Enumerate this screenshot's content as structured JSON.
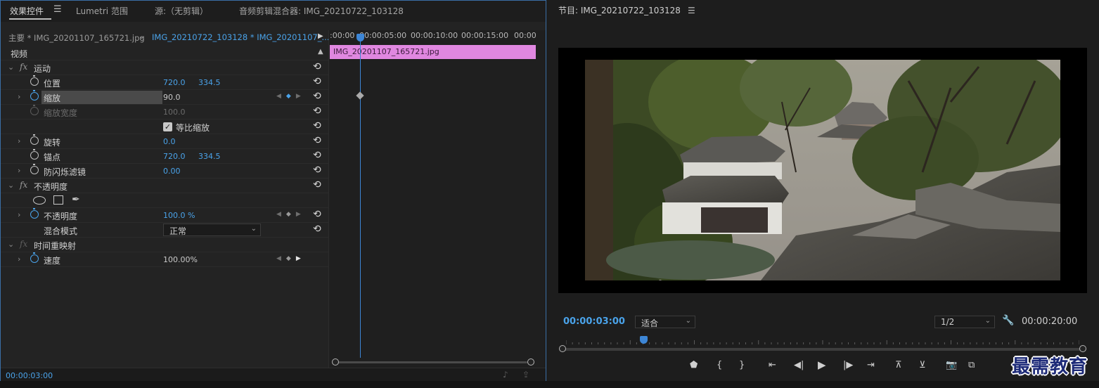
{
  "effect_controls": {
    "tabs": [
      {
        "label": "效果控件",
        "active": true
      },
      {
        "label": "Lumetri 范围",
        "active": false
      },
      {
        "label": "源:（无剪辑）",
        "active": false
      },
      {
        "label": "音频剪辑混合器: IMG_20210722_103128",
        "active": false
      }
    ],
    "menu_glyph": "☰",
    "source_master": "主要 * IMG_20201107_165721.jpg",
    "source_sequence": "IMG_20210722_103128 * IMG_20201107_...",
    "section_video": "视频",
    "motion": {
      "label": "运动",
      "position": {
        "label": "位置",
        "x": "720.0",
        "y": "334.5"
      },
      "scale": {
        "label": "缩放",
        "value": "90.0"
      },
      "scale_width": {
        "label": "缩放宽度",
        "value": "100.0"
      },
      "uniform_scale": {
        "label": "等比缩放",
        "checked": true
      },
      "rotation": {
        "label": "旋转",
        "value": "0.0"
      },
      "anchor": {
        "label": "锚点",
        "x": "720.0",
        "y": "334.5"
      },
      "anti_flicker": {
        "label": "防闪烁滤镜",
        "value": "0.00"
      }
    },
    "opacity": {
      "label": "不透明度",
      "opacity": {
        "label": "不透明度",
        "value": "100.0 %"
      },
      "blend_mode": {
        "label": "混合模式",
        "value": "正常"
      }
    },
    "time_remap": {
      "label": "时间重映射",
      "speed": {
        "label": "速度",
        "value": "100.00%"
      }
    },
    "timeline": {
      "ruler_labels": [
        ":00:00",
        "00:00:05:00",
        "00:00:10:00",
        "00:00:15:00",
        "00:00"
      ],
      "clip_name": "IMG_20201107_165721.jpg"
    },
    "footer_timecode": "00:00:03:00",
    "colors": {
      "accent": "#4aa3ea",
      "clip": "#e087e0",
      "playhead": "#3d86d6"
    }
  },
  "program_monitor": {
    "title": "节目: IMG_20210722_103128",
    "current_timecode": "00:00:03:00",
    "fit_select": "适合",
    "resolution_select": "1/2",
    "duration": "00:00:20:00",
    "playhead_fraction": 0.15
  },
  "watermark": "最需教育"
}
